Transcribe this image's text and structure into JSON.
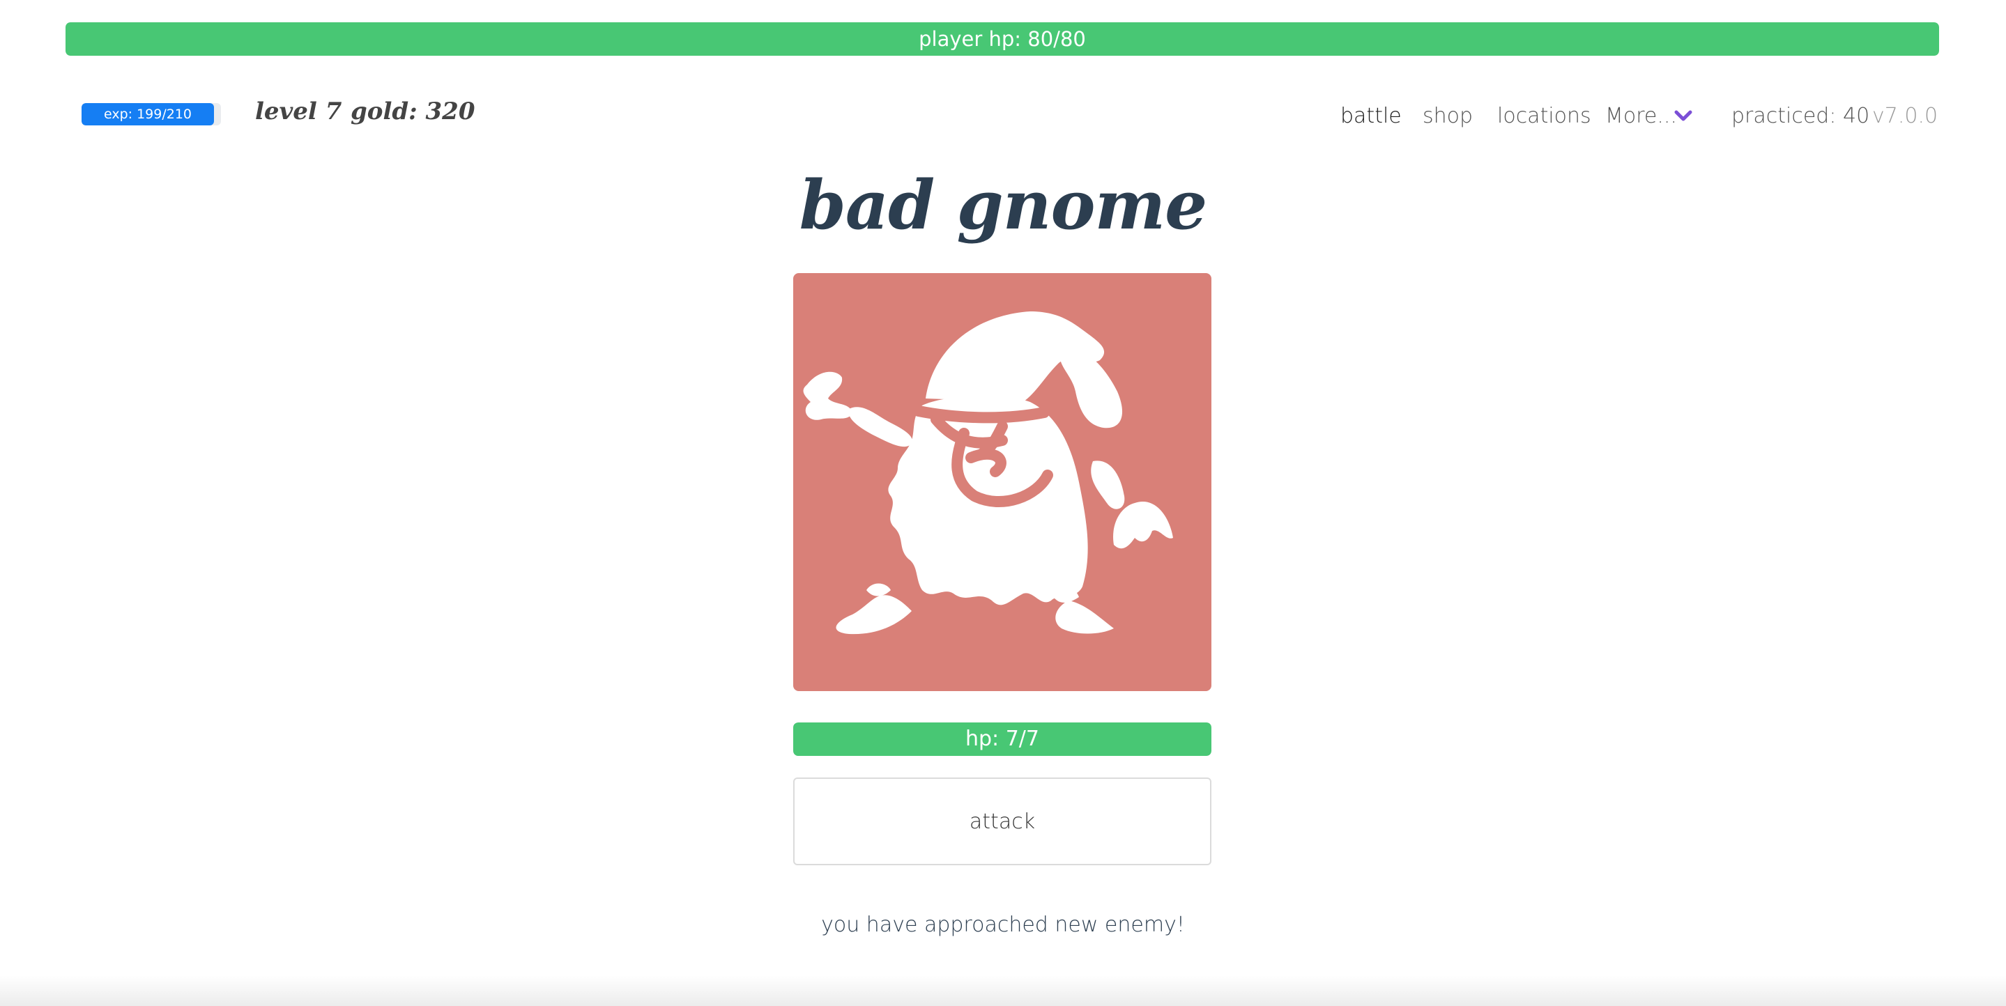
{
  "player": {
    "hp_label": "player hp: 80/80",
    "hp_fraction": 1.0,
    "exp_label": "exp: 199/210",
    "exp_fraction": 0.9476,
    "level_label": "level 7",
    "gold_label": "gold: 320"
  },
  "nav": {
    "battle": "battle",
    "shop": "shop",
    "locations": "locations",
    "more": "More...",
    "practiced": "practiced: 40",
    "version": "v7.0.0"
  },
  "enemy": {
    "name": "bad gnome",
    "image_icon": "gnome-icon",
    "hp_label": "hp: 7/7",
    "hp_fraction": 1.0
  },
  "actions": {
    "attack_label": "attack"
  },
  "message": "you have approached new enemy!",
  "colors": {
    "hp_green": "#48c774",
    "exp_blue": "#157ef3",
    "enemy_bg": "#d98078",
    "chevron_purple": "#7b4fd6",
    "title_dark": "#2c3e50"
  }
}
